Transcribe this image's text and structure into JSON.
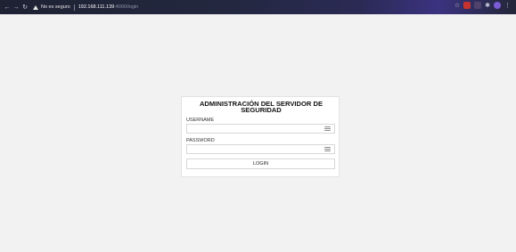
{
  "browser": {
    "security_text": "No es seguro",
    "url_host": "192.168.111.139",
    "url_rest": ":4000/login",
    "icons": {
      "back": "arrow-left-icon",
      "forward": "arrow-right-icon",
      "reload": "reload-icon",
      "warning": "warning-icon",
      "bookmark": "star-icon",
      "menu": "more-vert-icon"
    }
  },
  "login": {
    "title": "ADMINISTRACIÓN DEL SERVIDOR DE SEGURIDAD",
    "username_label": "USERNAME",
    "username_value": "",
    "password_label": "PASSWORD",
    "password_value": "",
    "button_label": "LOGIN"
  },
  "colors": {
    "page_background": "#f2f2f2",
    "card_background": "#ffffff",
    "border": "#d7d7d7"
  }
}
